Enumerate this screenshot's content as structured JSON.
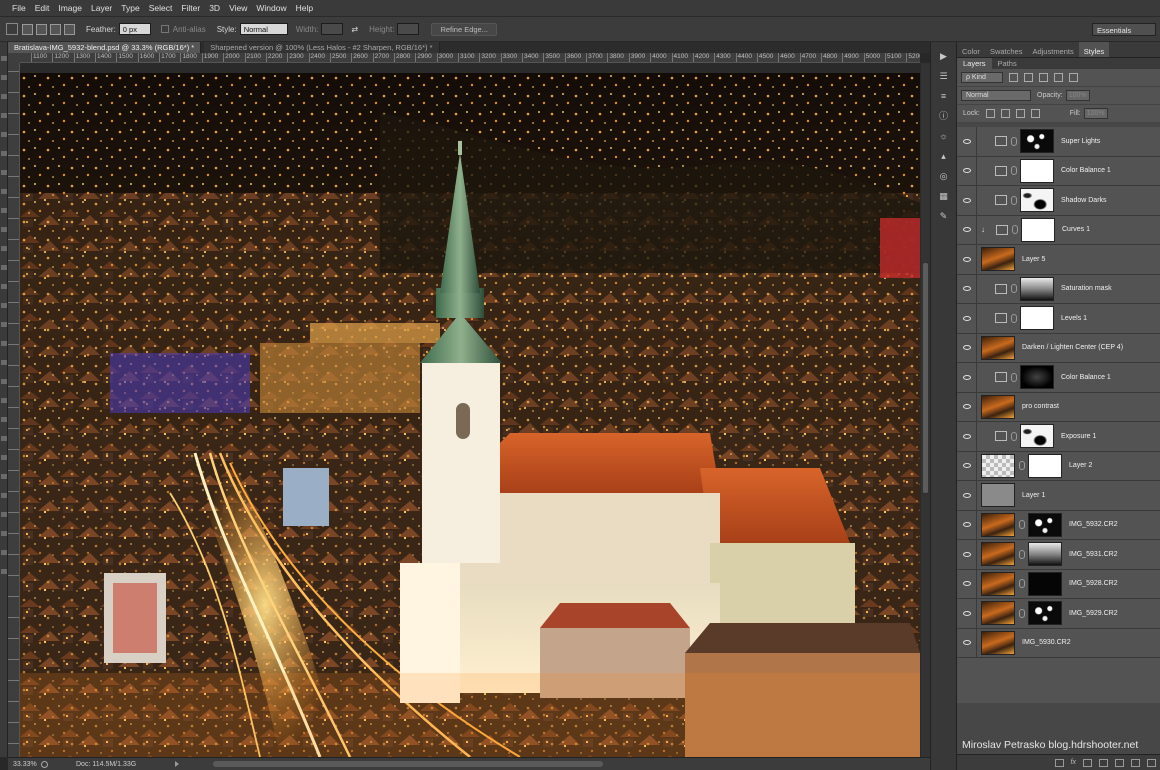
{
  "menu": [
    "File",
    "Edit",
    "Image",
    "Layer",
    "Type",
    "Select",
    "Filter",
    "3D",
    "View",
    "Window",
    "Help"
  ],
  "options": {
    "feather_label": "Feather:",
    "feather_value": "0 px",
    "antialias_label": "Anti-alias",
    "style_label": "Style:",
    "style_value": "Normal",
    "width_label": "Width:",
    "height_label": "Height:",
    "refine_edge": "Refine Edge...",
    "workspace": "Essentials"
  },
  "tabs": [
    {
      "label": "Bratislava-IMG_5932-blend.psd @ 33.3% (RGB/16*) *",
      "active": true
    },
    {
      "label": "Sharpened version @ 100% (Less Halos - #2 Sharpen, RGB/16*) *",
      "active": false
    }
  ],
  "ruler_ticks": [
    "1100",
    "1200",
    "1300",
    "1400",
    "1500",
    "1600",
    "1700",
    "1800",
    "1900",
    "2000",
    "2100",
    "2200",
    "2300",
    "2400",
    "2500",
    "2600",
    "2700",
    "2800",
    "2900",
    "3000",
    "3100",
    "3200",
    "3300",
    "3400",
    "3500",
    "3600",
    "3700",
    "3800",
    "3900",
    "4000",
    "4100",
    "4200",
    "4300",
    "4400",
    "4500",
    "4600",
    "4700",
    "4800",
    "4900",
    "5000",
    "5100",
    "5200"
  ],
  "status": {
    "zoom": "33.33%",
    "doc": "Doc: 114.5M/1.33G"
  },
  "panels": {
    "top_tabs": [
      {
        "label": "Color",
        "active": false
      },
      {
        "label": "Swatches",
        "active": false
      },
      {
        "label": "Adjustments",
        "active": false
      },
      {
        "label": "Styles",
        "active": true
      }
    ],
    "layer_tabs": [
      {
        "label": "Layers",
        "active": true
      },
      {
        "label": "Paths",
        "active": false
      }
    ],
    "kind_filter": "ρ Kind",
    "blend_mode": "Normal",
    "opacity_label": "Opacity:",
    "opacity_value": "100%",
    "lock_label": "Lock:",
    "fill_label": "Fill:",
    "fill_value": "100%"
  },
  "layers": [
    {
      "name": "Super Lights",
      "type": "adjustment",
      "icon": "curves-icon",
      "mask": "m-spots",
      "clipped": false
    },
    {
      "name": "Color Balance 1",
      "type": "adjustment",
      "icon": "balance-icon",
      "mask": "m-white",
      "clipped": false
    },
    {
      "name": "Shadow Darks",
      "type": "adjustment",
      "icon": "curves-icon",
      "mask": "m-mostwhite",
      "clipped": false
    },
    {
      "name": "Curves 1",
      "type": "adjustment",
      "icon": "curves-icon",
      "mask": "m-white",
      "clipped": true
    },
    {
      "name": "Layer 5",
      "type": "pixel",
      "thumb": "t-photo"
    },
    {
      "name": "Saturation mask",
      "type": "adjustment",
      "icon": "huesat-icon",
      "mask": "m-gray",
      "clipped": false
    },
    {
      "name": "Levels 1",
      "type": "adjustment",
      "icon": "levels-icon",
      "mask": "m-white",
      "clipped": false
    },
    {
      "name": "Darken / Lighten Center (CEP 4)",
      "type": "pixel",
      "thumb": "t-photo"
    },
    {
      "name": "Color Balance 1",
      "type": "adjustment",
      "icon": "balance-icon",
      "mask": "m-vignette",
      "clipped": false
    },
    {
      "name": "pro contrast",
      "type": "pixel",
      "thumb": "t-photo"
    },
    {
      "name": "Exposure 1",
      "type": "adjustment",
      "icon": "exposure-icon",
      "mask": "m-mostwhite",
      "clipped": false
    },
    {
      "name": "Layer 2",
      "type": "masked",
      "thumb": "t-check",
      "mask": "m-white"
    },
    {
      "name": "Layer 1",
      "type": "pixel",
      "thumb": "t-gray"
    },
    {
      "name": "IMG_5932.CR2",
      "type": "masked",
      "thumb": "t-photo",
      "mask": "m-spots"
    },
    {
      "name": "IMG_5931.CR2",
      "type": "masked",
      "thumb": "t-photo",
      "mask": "m-gray"
    },
    {
      "name": "IMG_5928.CR2",
      "type": "masked",
      "thumb": "t-photo",
      "mask": "m-black"
    },
    {
      "name": "IMG_5929.CR2",
      "type": "masked",
      "thumb": "t-photo",
      "mask": "m-spots"
    },
    {
      "name": "IMG_5930.CR2",
      "type": "pixel",
      "thumb": "t-photo"
    }
  ],
  "watermark": "Miroslav  Petrasko  blog.hdrshooter.net"
}
